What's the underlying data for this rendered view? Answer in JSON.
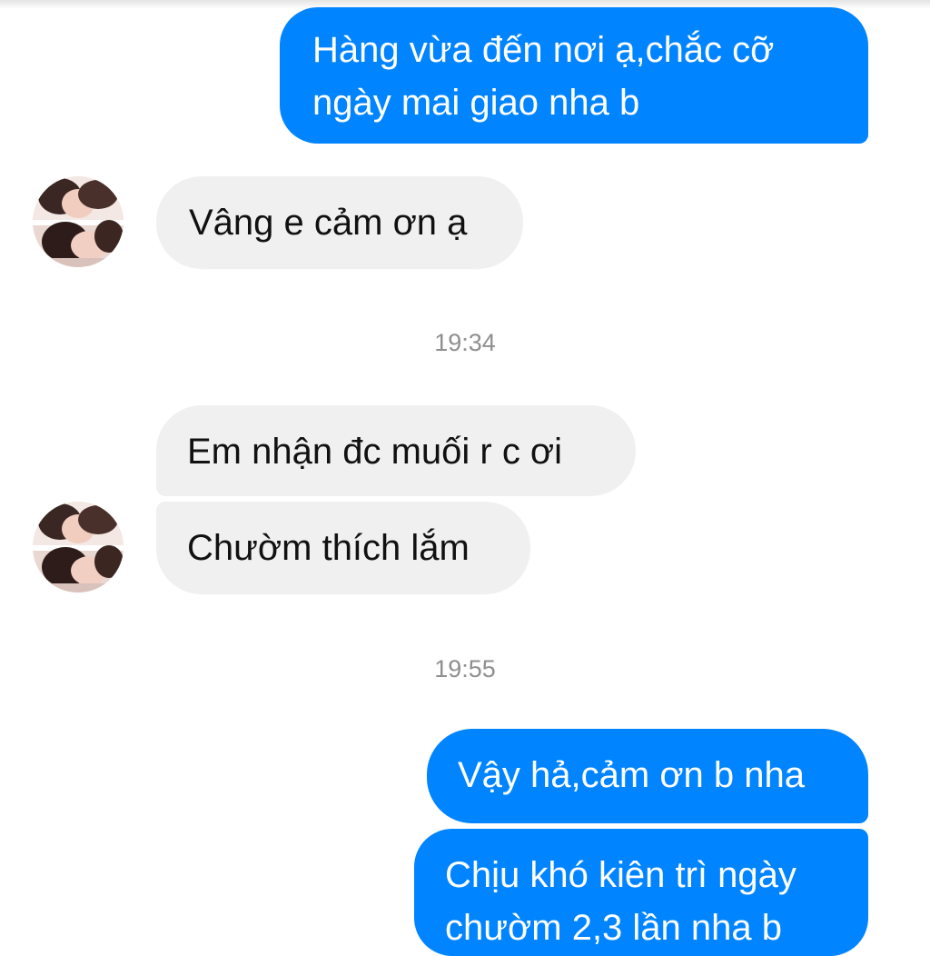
{
  "theme": {
    "accent": "#0084ff",
    "incoming_bubble": "#f1f0f0"
  },
  "conversation": {
    "messages": [
      {
        "direction": "outgoing",
        "lines": [
          "Hàng vừa đến nơi ạ,chắc cỡ",
          "ngày mai giao nha b"
        ]
      },
      {
        "direction": "incoming",
        "lines": [
          "Vâng e cảm ơn ạ"
        ]
      },
      {
        "direction": "timestamp",
        "text": "19:34"
      },
      {
        "direction": "incoming",
        "lines": [
          "Em nhận đc muối r c ơi"
        ]
      },
      {
        "direction": "incoming",
        "lines": [
          "Chườm thích lắm"
        ]
      },
      {
        "direction": "timestamp",
        "text": "19:55"
      },
      {
        "direction": "outgoing",
        "lines": [
          "Vậy hả,cảm ơn b nha"
        ]
      },
      {
        "direction": "outgoing",
        "lines": [
          "Chịu khó kiên trì ngày",
          "chườm 2,3 lần nha b"
        ]
      }
    ]
  },
  "avatar": {
    "icon": "contact-avatar-photo"
  }
}
